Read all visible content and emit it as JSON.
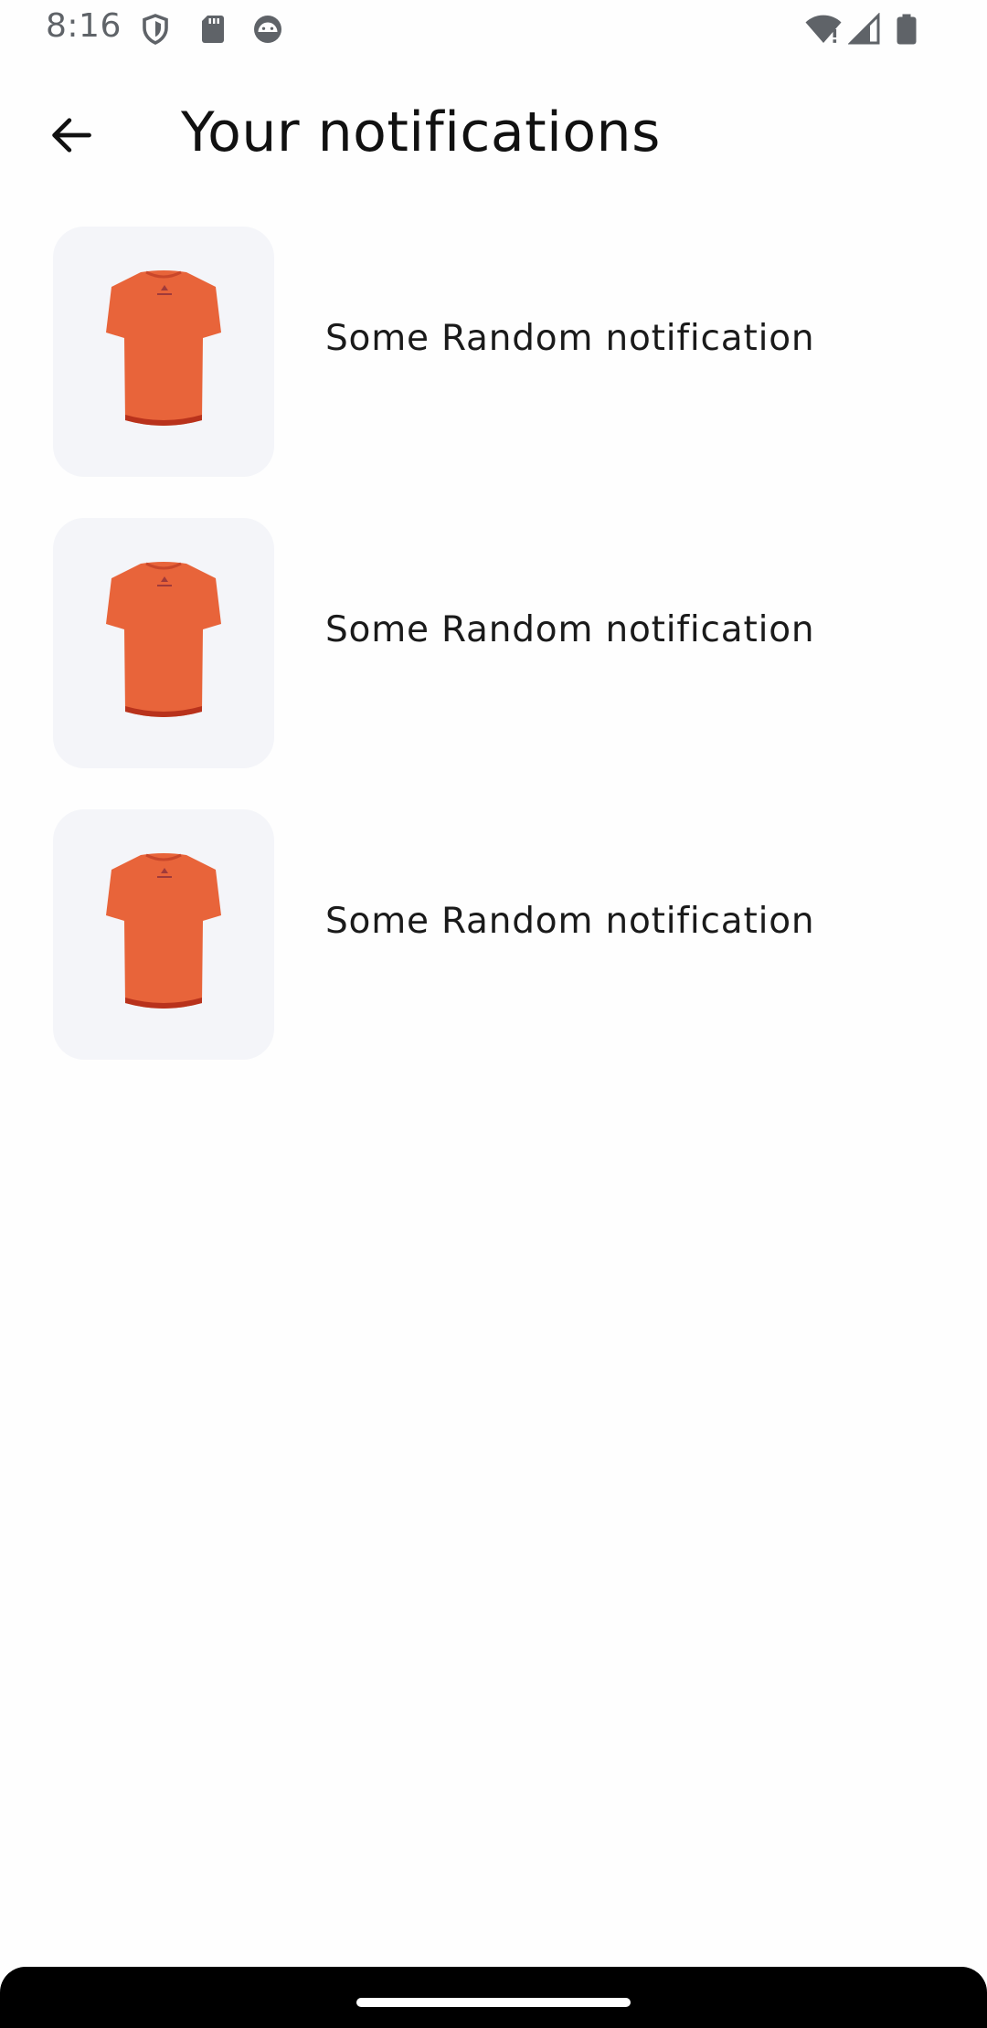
{
  "status_bar": {
    "time": "8:16",
    "icons_left": [
      "shield-icon",
      "sd-card-icon",
      "android-head-icon"
    ],
    "icons_right": [
      "wifi-icon",
      "cell-signal-icon",
      "battery-icon"
    ]
  },
  "header": {
    "title": "Your notifications",
    "back_icon": "arrow-left-icon"
  },
  "notifications": [
    {
      "text": "Some Random notification",
      "thumbnail": "orange-tshirt"
    },
    {
      "text": "Some Random notification",
      "thumbnail": "orange-tshirt"
    },
    {
      "text": "Some Random notification",
      "thumbnail": "orange-tshirt"
    }
  ],
  "colors": {
    "background": "#fefefe",
    "thumb_bg": "#f4f5f9",
    "shirt": "#e8643a",
    "shirt_hem": "#b8321c",
    "title": "#111111",
    "status": "#5f6368"
  }
}
